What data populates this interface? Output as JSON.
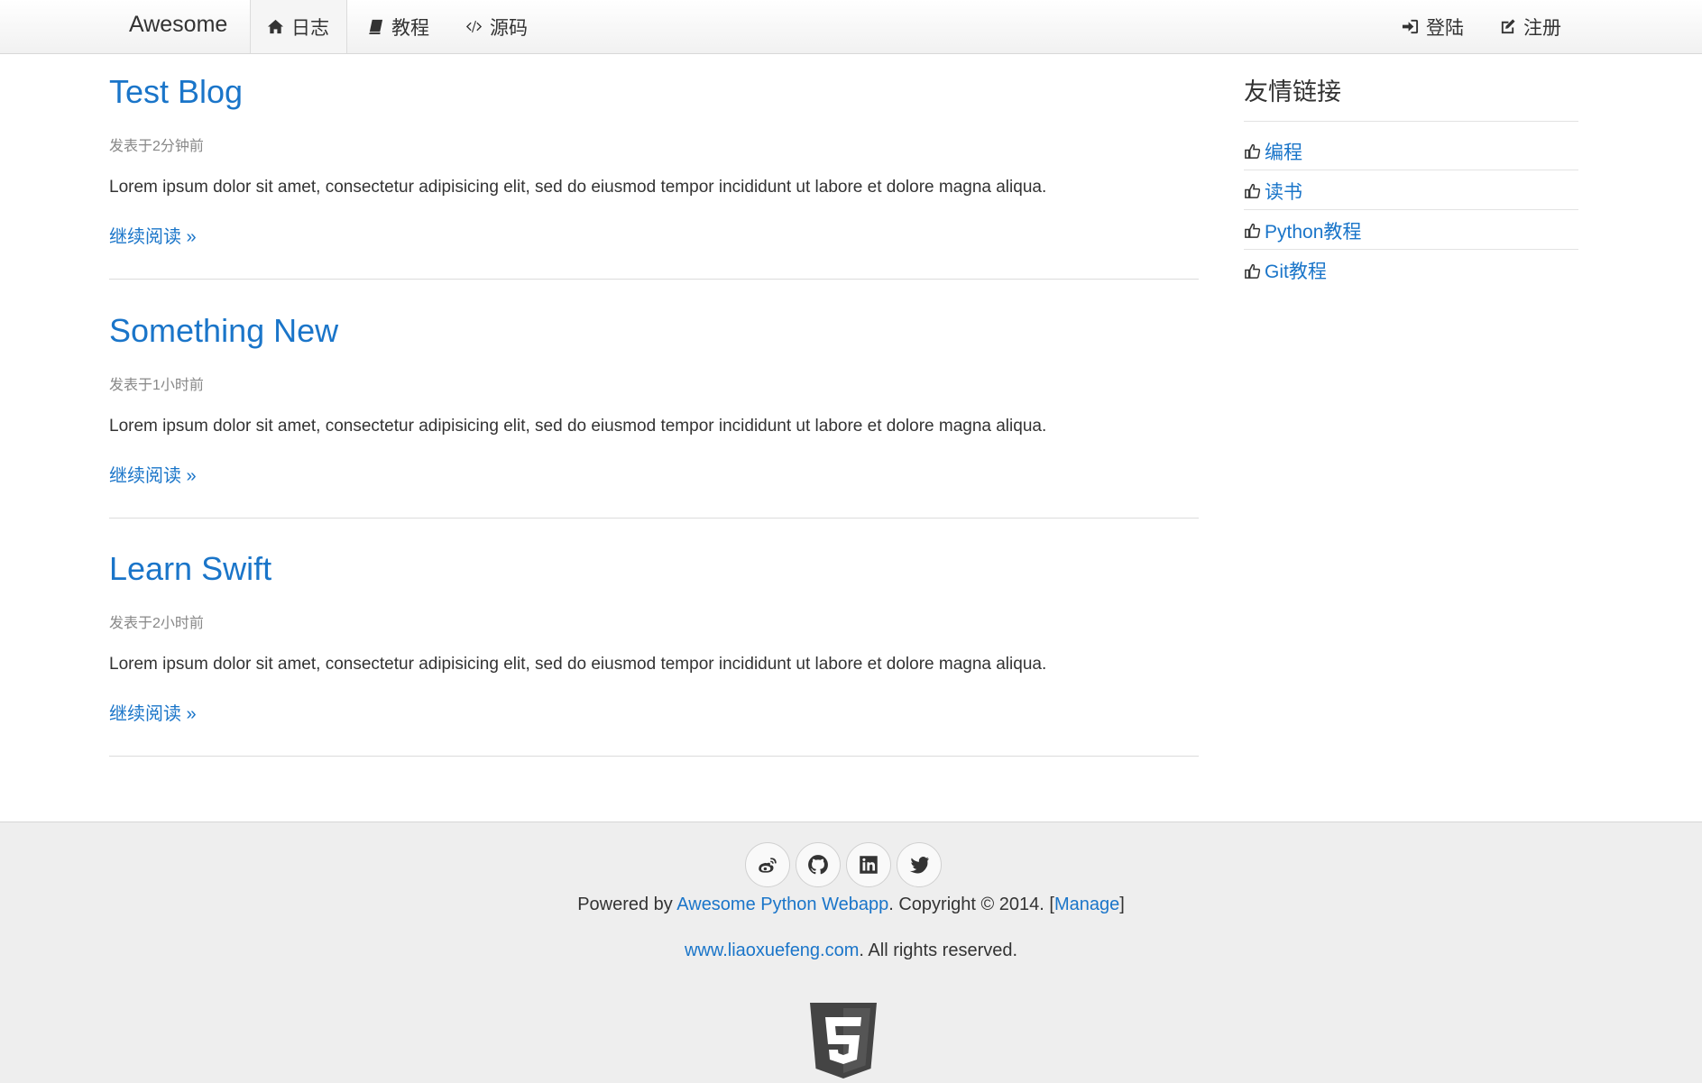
{
  "navbar": {
    "brand": "Awesome",
    "items": [
      {
        "label": "日志",
        "icon": "home-icon",
        "active": true
      },
      {
        "label": "教程",
        "icon": "book-icon"
      },
      {
        "label": "源码",
        "icon": "code-icon"
      }
    ],
    "right_items": [
      {
        "label": "登陆",
        "icon": "sign-in-icon"
      },
      {
        "label": "注册",
        "icon": "edit-icon"
      }
    ]
  },
  "articles": [
    {
      "title": "Test Blog",
      "meta": "发表于2分钟前",
      "summary": "Lorem ipsum dolor sit amet, consectetur adipisicing elit, sed do eiusmod tempor incididunt ut labore et dolore magna aliqua.",
      "more": "继续阅读 »"
    },
    {
      "title": "Something New",
      "meta": "发表于1小时前",
      "summary": "Lorem ipsum dolor sit amet, consectetur adipisicing elit, sed do eiusmod tempor incididunt ut labore et dolore magna aliqua.",
      "more": "继续阅读 »"
    },
    {
      "title": "Learn Swift",
      "meta": "发表于2小时前",
      "summary": "Lorem ipsum dolor sit amet, consectetur adipisicing elit, sed do eiusmod tempor incididunt ut labore et dolore magna aliqua.",
      "more": "继续阅读 »"
    }
  ],
  "sidebar": {
    "title": "友情链接",
    "links": [
      {
        "label": "编程",
        "icon": "thumbs-up-icon"
      },
      {
        "label": "读书",
        "icon": "thumbs-up-icon"
      },
      {
        "label": "Python教程",
        "icon": "thumbs-up-icon"
      },
      {
        "label": "Git教程",
        "icon": "thumbs-up-icon"
      }
    ]
  },
  "footer": {
    "social_icons": [
      "weibo-icon",
      "github-icon",
      "linkedin-icon",
      "twitter-icon"
    ],
    "powered_prefix": "Powered by ",
    "powered_link": "Awesome Python Webapp",
    "copyright": ". Copyright © 2014. [",
    "manage_link": "Manage",
    "copyright_end": "]",
    "site_link": "www.liaoxuefeng.com",
    "rights": ". All rights reserved.",
    "badge_icon": "html5-icon"
  },
  "colors": {
    "link": "#1a75c9",
    "text": "#333333",
    "muted": "#888888",
    "footer_bg": "#eeeeee"
  }
}
